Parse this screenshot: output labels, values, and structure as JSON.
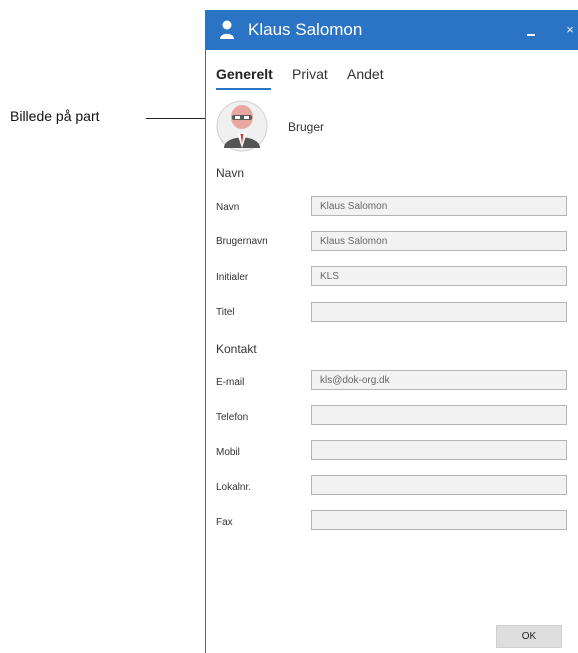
{
  "callout": {
    "label": "Billede på part"
  },
  "window": {
    "title": "Klaus Salomon",
    "minimize_icon": "minimize-icon",
    "close_label": "×",
    "user_icon": "user-icon"
  },
  "tabs": [
    {
      "label": "Generelt",
      "active": true
    },
    {
      "label": "Privat",
      "active": false
    },
    {
      "label": "Andet",
      "active": false
    }
  ],
  "profile": {
    "avatar_icon": "avatar-icon",
    "role": "Bruger"
  },
  "sections": {
    "name_heading": "Navn",
    "contact_heading": "Kontakt"
  },
  "fields": {
    "navn": {
      "label": "Navn",
      "value": "Klaus Salomon"
    },
    "brugernavn": {
      "label": "Brugernavn",
      "value": "Klaus Salomon"
    },
    "initialer": {
      "label": "Initialer",
      "value": "KLS"
    },
    "titel": {
      "label": "Titel",
      "value": ""
    },
    "email": {
      "label": "E-mail",
      "value": "kls@dok-org.dk"
    },
    "telefon": {
      "label": "Telefon",
      "value": ""
    },
    "mobil": {
      "label": "Mobil",
      "value": ""
    },
    "lokalnr": {
      "label": "Lokalnr.",
      "value": ""
    },
    "fax": {
      "label": "Fax",
      "value": ""
    }
  },
  "footer": {
    "ok_label": "OK"
  },
  "colors": {
    "accent": "#2b73c5",
    "field_bg": "#f2f2f2",
    "field_border": "#b4b4b4"
  }
}
